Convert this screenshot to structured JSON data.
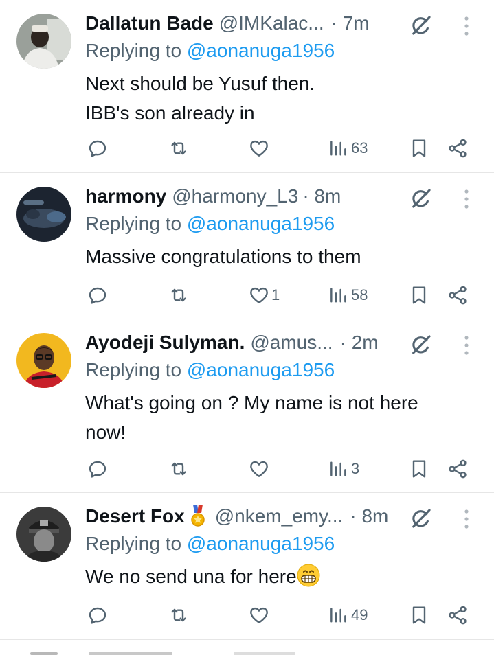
{
  "tweets": [
    {
      "name": "Dallatun Bade",
      "handle": "@IMKalac...",
      "time": "· 7m",
      "replying_prefix": "Replying to ",
      "replying_to": "@aonanuga1956",
      "text_lines": [
        "Next should be Yusuf then.",
        "IBB's son already in"
      ],
      "likes": "",
      "views": "63"
    },
    {
      "name": "harmony",
      "handle": "@harmony_L3",
      "time": "· 8m",
      "replying_prefix": "Replying to ",
      "replying_to": "@aonanuga1956",
      "text_lines": [
        "Massive congratulations to them"
      ],
      "likes": "1",
      "views": "58"
    },
    {
      "name": "Ayodeji Sulyman.",
      "handle": "@amus...",
      "time": "· 2m",
      "replying_prefix": "Replying to ",
      "replying_to": "@aonanuga1956",
      "text_lines": [
        "What's going on ? My name is not here",
        "now!"
      ],
      "likes": "",
      "views": "3"
    },
    {
      "name": "Desert Fox",
      "handle": "@nkem_emy...",
      "time": "· 8m",
      "replying_prefix": "Replying to ",
      "replying_to": "@aonanuga1956",
      "text_lines": [
        "We no send una for here"
      ],
      "likes": "",
      "views": "49"
    }
  ],
  "icons": {
    "reply": "reply-icon",
    "retweet": "retweet-icon",
    "like": "heart-icon",
    "views": "views-icon",
    "bookmark": "bookmark-icon",
    "share": "share-icon",
    "grok": "grok-icon",
    "more": "more-vertical-icon"
  },
  "colors": {
    "link": "#1d9bf0",
    "secondary": "#536471",
    "primary": "#0f1419"
  }
}
